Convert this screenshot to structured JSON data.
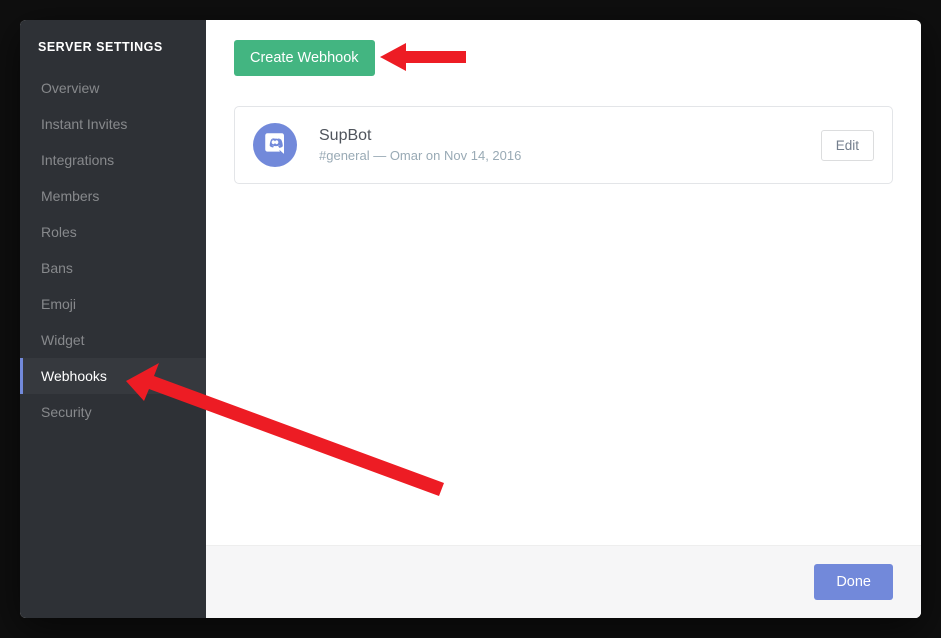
{
  "sidebar": {
    "title": "SERVER SETTINGS",
    "items": [
      {
        "label": "Overview"
      },
      {
        "label": "Instant Invites"
      },
      {
        "label": "Integrations"
      },
      {
        "label": "Members"
      },
      {
        "label": "Roles"
      },
      {
        "label": "Bans"
      },
      {
        "label": "Emoji"
      },
      {
        "label": "Widget"
      },
      {
        "label": "Webhooks"
      },
      {
        "label": "Security"
      }
    ],
    "activeIndex": 8
  },
  "content": {
    "createButton": "Create Webhook",
    "webhook": {
      "name": "SupBot",
      "meta": "#general — Omar on Nov 14, 2016",
      "editLabel": "Edit"
    }
  },
  "footer": {
    "doneLabel": "Done"
  }
}
